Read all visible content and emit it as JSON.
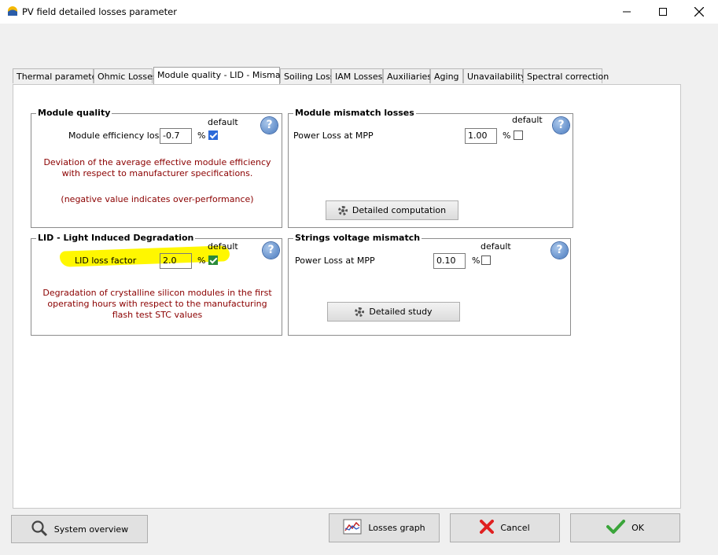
{
  "window": {
    "title": "PV field detailed losses parameter",
    "minimize_icon": "minimize-icon",
    "maximize_icon": "maximize-icon",
    "close_icon": "close-icon"
  },
  "tabs": [
    {
      "label": "Thermal parameter"
    },
    {
      "label": "Ohmic Losses"
    },
    {
      "label": "Module quality - LID - Mismatch",
      "active": true
    },
    {
      "label": "Soiling Loss"
    },
    {
      "label": "IAM Losses"
    },
    {
      "label": "Auxiliaries"
    },
    {
      "label": "Aging"
    },
    {
      "label": "Unavailability"
    },
    {
      "label": "Spectral correction"
    }
  ],
  "module_quality": {
    "title": "Module quality",
    "default_label": "default",
    "field_label": "Module efficiency loss",
    "value": "-0.7",
    "unit": "%",
    "default_checked": true,
    "desc1": "Deviation of the average effective module efficiency with respect to manufacturer specifications.",
    "desc2": "(negative value indicates over-performance)"
  },
  "mismatch": {
    "title": "Module mismatch losses",
    "default_label": "default",
    "field_label": "Power Loss at MPP",
    "value": "1.00",
    "unit": "%",
    "default_checked": false,
    "button": "Detailed computation"
  },
  "lid": {
    "title": "LID - Light Induced Degradation",
    "default_label": "default",
    "field_label": "LID loss factor",
    "value": "2.0",
    "unit": "%",
    "default_checked": true,
    "desc": "Degradation of crystalline silicon modules in the first operating hours with respect to the manufacturing flash test STC values"
  },
  "strings": {
    "title": "Strings voltage mismatch",
    "default_label": "default",
    "field_label": "Power Loss at MPP",
    "value": "0.10",
    "unit": "%",
    "default_checked": false,
    "button": "Detailed study"
  },
  "help_glyph": "?",
  "footer": {
    "system_overview": "System overview",
    "losses_graph": "Losses graph",
    "cancel": "Cancel",
    "ok": "OK"
  },
  "colors": {
    "highlight": "#fff700",
    "description_text": "#8b0000",
    "checkbox_checked": "#2d6ad9"
  }
}
